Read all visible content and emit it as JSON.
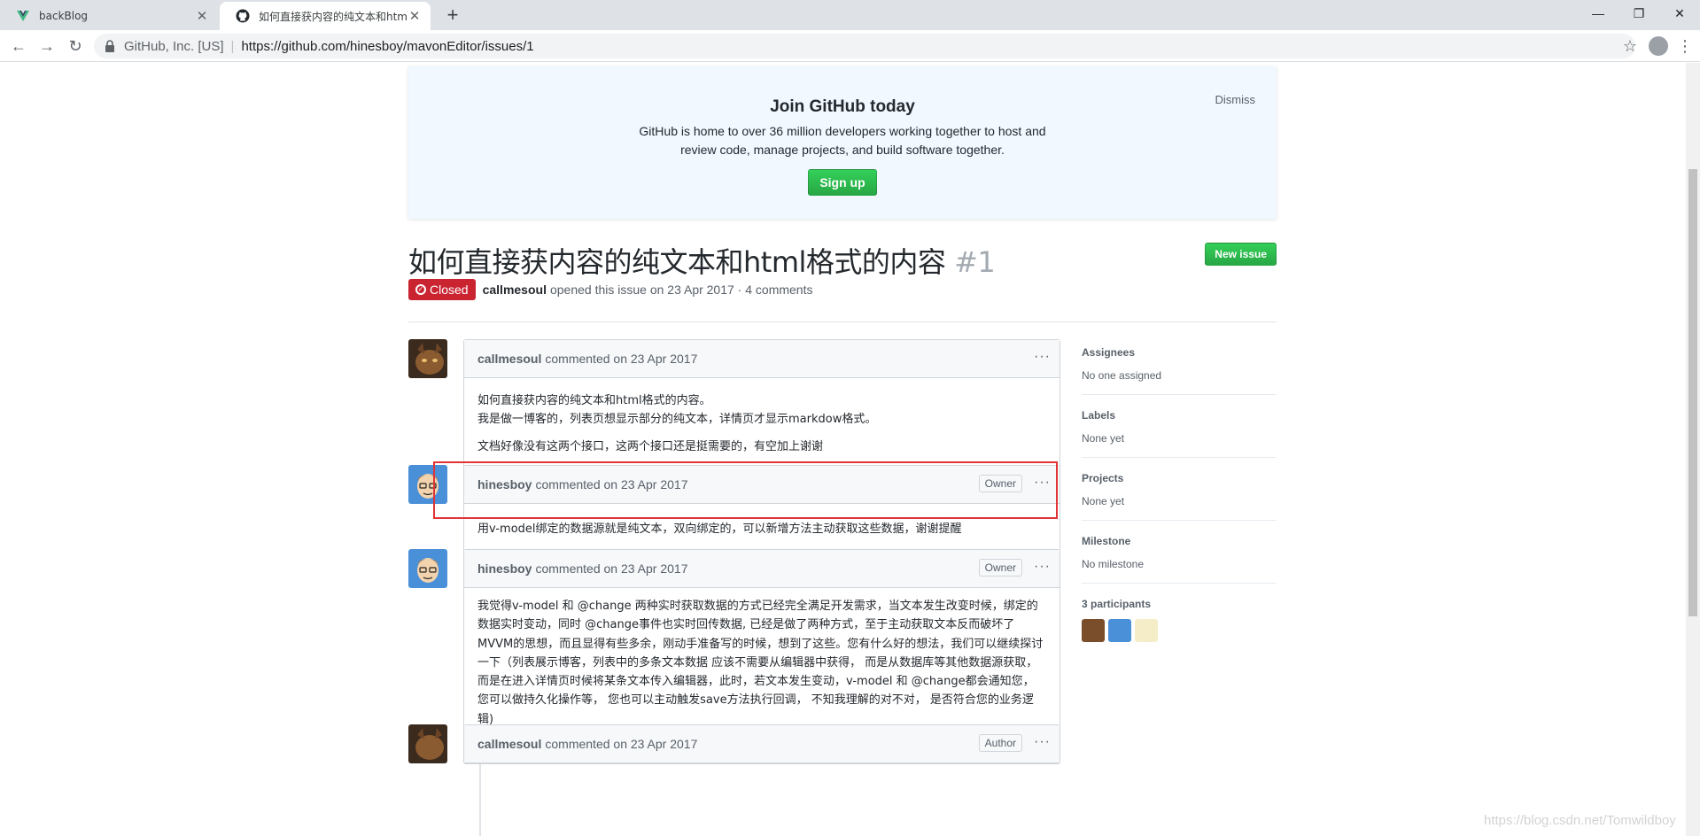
{
  "browser": {
    "tabs": [
      {
        "title": "backBlog",
        "active": false
      },
      {
        "title": "如何直接获内容的纯文本和html格式的内容",
        "active": true
      }
    ],
    "address": {
      "org": "GitHub, Inc. [US]",
      "url": "https://github.com/hinesboy/mavonEditor/issues/1"
    }
  },
  "banner": {
    "title": "Join GitHub today",
    "text": "GitHub is home to over 36 million developers working together to host and review code, manage projects, and build software together.",
    "signup_label": "Sign up",
    "dismiss_label": "Dismiss"
  },
  "issue": {
    "title": "如何直接获内容的纯文本和html格式的内容",
    "number": "#1",
    "new_issue_label": "New issue",
    "state": "Closed",
    "author": "callmesoul",
    "meta_text": "opened this issue on 23 Apr 2017 · 4 comments"
  },
  "comments": [
    {
      "author": "callmesoul",
      "action": "commented on 23 Apr 2017",
      "badge": "",
      "paragraphs": [
        "如何直接获内容的纯文本和html格式的内容。\n我是做一博客的，列表页想显示部分的纯文本，详情页才显示markdow格式。",
        "文档好像没有这两个接口，这两个接口还是挺需要的，有空加上谢谢"
      ]
    },
    {
      "author": "hinesboy",
      "action": "commented on 23 Apr 2017",
      "badge": "Owner",
      "paragraphs": [
        "用v-model绑定的数据源就是纯文本，双向绑定的，可以新增方法主动获取这些数据，谢谢提醒"
      ]
    },
    {
      "author": "hinesboy",
      "action": "commented on 23 Apr 2017",
      "badge": "Owner",
      "paragraphs": [
        "我觉得v-model 和 @change 两种实时获取数据的方式已经完全满足开发需求，当文本发生改变时候，绑定的数据实时变动，同时 @change事件也实时回传数据, 已经是做了两种方式，至于主动获取文本反而破坏了MVVM的思想，而且显得有些多余，刚动手准备写的时候，想到了这些。您有什么好的想法，我们可以继续探讨一下（列表展示博客，列表中的多条文本数据 应该不需要从编辑器中获得， 而是从数据库等其他数据源获取， 而是在进入详情页时候将某条文本传入编辑器，此时，若文本发生变动，v-model 和 @change都会通知您， 您可以做持久化操作等， 您也可以主动触发save方法执行回调， 不知我理解的对不对， 是否符合您的业务逻辑)"
      ]
    },
    {
      "author": "callmesoul",
      "action": "commented on 23 Apr 2017",
      "badge": "Author",
      "paragraphs": []
    }
  ],
  "sidebar": {
    "assignees": {
      "title": "Assignees",
      "value": "No one assigned"
    },
    "labels": {
      "title": "Labels",
      "value": "None yet"
    },
    "projects": {
      "title": "Projects",
      "value": "None yet"
    },
    "milestone": {
      "title": "Milestone",
      "value": "No milestone"
    },
    "participants": {
      "title": "3 participants"
    }
  },
  "watermark": "https://blog.csdn.net/Tomwildboy",
  "colors": {
    "closed": "#cb2431",
    "green": "#28a745",
    "annotation": "#e03436"
  }
}
